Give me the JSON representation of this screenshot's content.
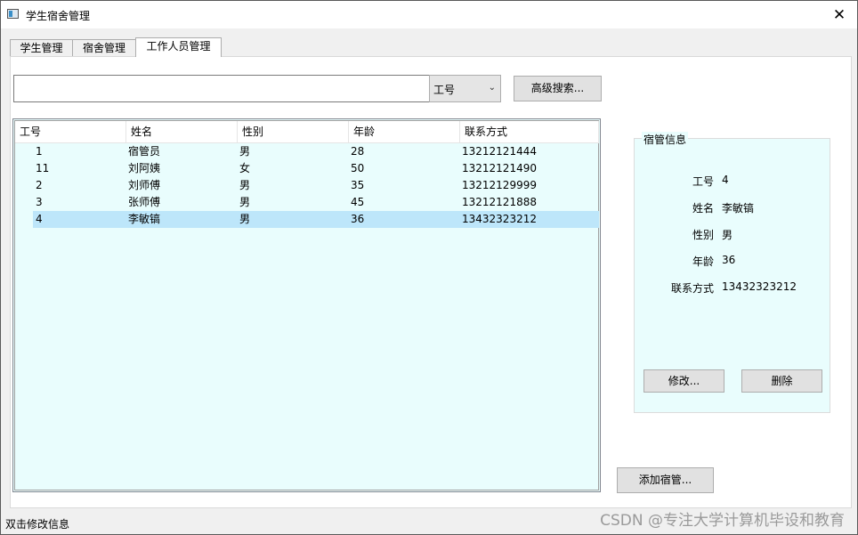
{
  "window": {
    "title": "学生宿舍管理",
    "close_glyph": "✕"
  },
  "tabs": [
    {
      "label": "学生管理",
      "active": false
    },
    {
      "label": "宿舍管理",
      "active": false
    },
    {
      "label": "工作人员管理",
      "active": true
    }
  ],
  "search": {
    "value": "",
    "field_selected": "工号",
    "dropdown_glyph": "⌄",
    "advanced_label": "高级搜索..."
  },
  "table": {
    "columns": [
      "工号",
      "姓名",
      "性别",
      "年龄",
      "联系方式"
    ],
    "rows": [
      {
        "id": "1",
        "name": "宿管员",
        "gender": "男",
        "age": "28",
        "phone": "13212121444",
        "selected": false
      },
      {
        "id": "11",
        "name": "刘阿姨",
        "gender": "女",
        "age": "50",
        "phone": "13212121490",
        "selected": false
      },
      {
        "id": "2",
        "name": "刘师傅",
        "gender": "男",
        "age": "35",
        "phone": "13212129999",
        "selected": false
      },
      {
        "id": "3",
        "name": "张师傅",
        "gender": "男",
        "age": "45",
        "phone": "13212121888",
        "selected": false
      },
      {
        "id": "4",
        "name": "李敏镐",
        "gender": "男",
        "age": "36",
        "phone": "13432323212",
        "selected": true
      }
    ]
  },
  "info_panel": {
    "title": "宿管信息",
    "fields": [
      {
        "label": "工号",
        "value": "4"
      },
      {
        "label": "姓名",
        "value": "李敏镐"
      },
      {
        "label": "性别",
        "value": "男"
      },
      {
        "label": "年龄",
        "value": "36"
      },
      {
        "label": "联系方式",
        "value": "13432323212"
      }
    ],
    "edit_label": "修改...",
    "delete_label": "删除"
  },
  "add_button_label": "添加宿管...",
  "status_text": "双击修改信息",
  "watermark": "CSDN @专注大学计算机毕设和教育",
  "colors": {
    "table_background": "#e9fdfd",
    "selected_row": "#bde6fa"
  }
}
